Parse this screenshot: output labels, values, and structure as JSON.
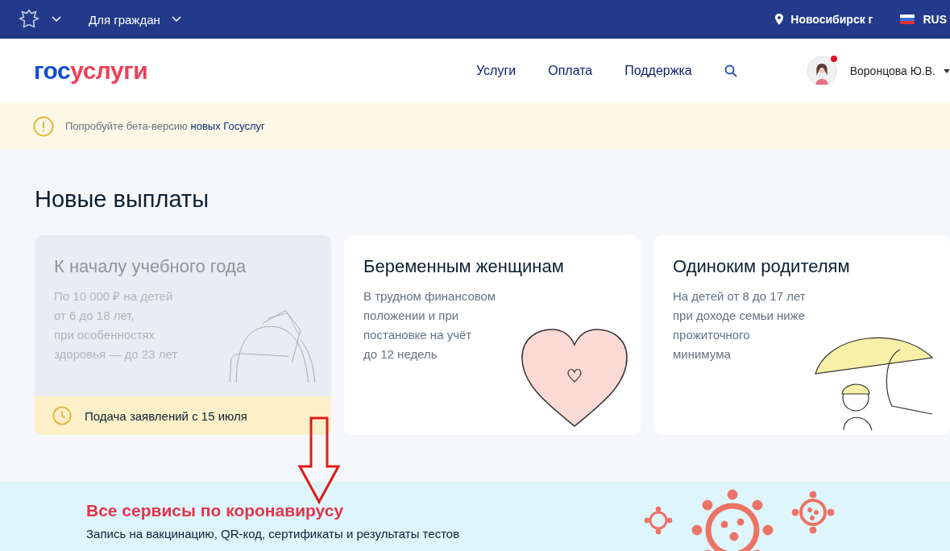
{
  "top_bar": {
    "audience": "Для граждан",
    "location": "Новосибирск г",
    "language": "RUS"
  },
  "header": {
    "logo_parts": [
      "гос",
      "услуги"
    ],
    "nav": [
      "Услуги",
      "Оплата",
      "Поддержка"
    ],
    "user": {
      "name": "Воронцова Ю.В.",
      "has_notification": true
    }
  },
  "beta_banner": {
    "text": "Попробуйте бета-версию ",
    "link": "новых Госуслуг"
  },
  "section_title": "Новые выплаты",
  "cards": [
    {
      "kind": "backpack",
      "disabled": true,
      "title": "К началу учебного года",
      "lines": [
        "По 10 000 ₽ на детей",
        "от 6 до 18 лет,",
        "при особенностях",
        "здоровья — до 23 лет"
      ],
      "notice": "Подача заявлений с 15 июля"
    },
    {
      "kind": "heart",
      "disabled": false,
      "title": "Беременным женщинам",
      "lines": [
        "В трудном финансовом",
        "положении и при",
        "постановке на учёт",
        "до 12 недель"
      ]
    },
    {
      "kind": "umbrella",
      "disabled": false,
      "title": "Одиноким родителям",
      "lines": [
        "На детей от 8 до 17 лет",
        "при доходе семьи ниже",
        "прожиточного",
        "минимума"
      ]
    }
  ],
  "covid": {
    "title": "Все сервисы по коронавирусу",
    "subtitle": "Запись на вакцинацию, QR-код, сертификаты и результаты тестов"
  }
}
